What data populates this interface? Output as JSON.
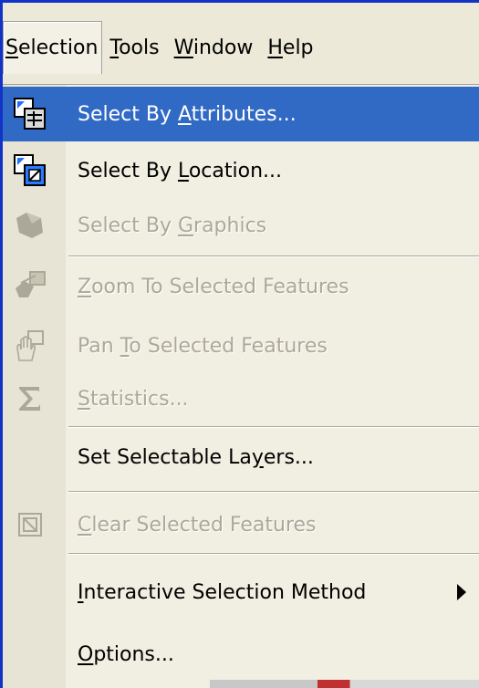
{
  "menubar": {
    "items": [
      "Selection",
      "Tools",
      "Window",
      "Help"
    ]
  },
  "menu": {
    "items": [
      {
        "label": "Select By Attributes...",
        "icon": "select-by-attributes-icon",
        "enabled": true,
        "highlighted": true
      },
      {
        "label": "Select By Location...",
        "icon": "select-by-location-icon",
        "enabled": true
      },
      {
        "label": "Select By Graphics",
        "icon": "select-by-graphics-icon",
        "enabled": false
      },
      {
        "label": "Zoom To Selected Features",
        "icon": "zoom-to-selected-icon",
        "enabled": false
      },
      {
        "label": "Pan To Selected Features",
        "icon": "pan-hand-icon",
        "enabled": false
      },
      {
        "label": "Statistics...",
        "icon": "sigma-icon",
        "enabled": false
      },
      {
        "label": "Set Selectable Layers...",
        "enabled": true
      },
      {
        "label": "Clear Selected Features",
        "icon": "clear-selection-icon",
        "enabled": false
      },
      {
        "label": "Interactive Selection Method",
        "enabled": true,
        "submenu": true
      },
      {
        "label": "Options...",
        "enabled": true
      }
    ]
  },
  "colors": {
    "highlight": "#316ac5",
    "disabled_text": "#aca899",
    "window_border": "#1233c8"
  }
}
